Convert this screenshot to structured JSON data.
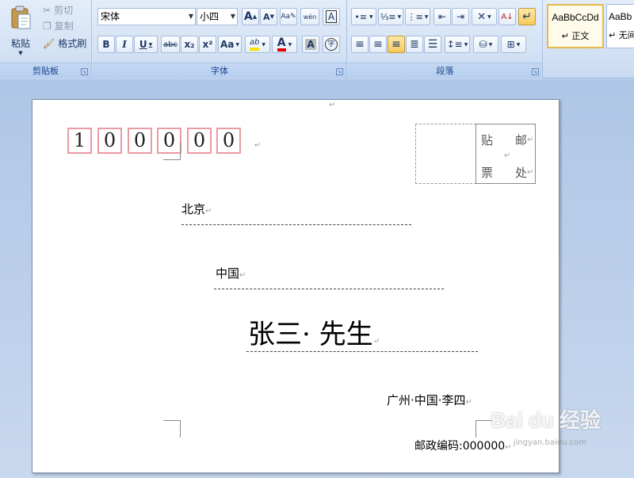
{
  "clipboard": {
    "paste_label": "粘贴",
    "cut_label": "剪切",
    "copy_label": "复制",
    "format_painter_label": "格式刷",
    "group_label": "剪贴板"
  },
  "font": {
    "font_name": "宋体",
    "font_size": "小四",
    "grow_label": "A",
    "shrink_label": "A",
    "phonetic_label": "wén",
    "border_label": "A",
    "bold_label": "B",
    "italic_label": "I",
    "underline_label": "U",
    "strike_label": "abc",
    "subscript_label": "x₂",
    "superscript_label": "x²",
    "case_label": "Aa",
    "highlight_label": "ab",
    "color_label": "A",
    "shade_label": "A",
    "enclose_label": "字",
    "group_label": "字体",
    "highlight_color": "#f5e400",
    "font_color": "#e00000"
  },
  "paragraph": {
    "group_label": "段落"
  },
  "styles": {
    "items": [
      {
        "sample": "AaBbCcDd",
        "name": "↵ 正文"
      },
      {
        "sample": "AaBb",
        "name": "↵ 无间"
      }
    ]
  },
  "document": {
    "zip_digits": [
      "1",
      "0",
      "0",
      "0",
      "0",
      "0"
    ],
    "stamp_chars": [
      "贴",
      "邮",
      "票",
      "处"
    ],
    "recipient_city": "北京",
    "recipient_country": "中国",
    "recipient_name": "张三· 先生",
    "sender_address": "广州·中国·李四",
    "sender_postcode": "邮政编码:000000",
    "para_mark": "↵"
  },
  "watermark": {
    "brand": "Bai du 经验",
    "url": "jingyan.baidu.com"
  }
}
